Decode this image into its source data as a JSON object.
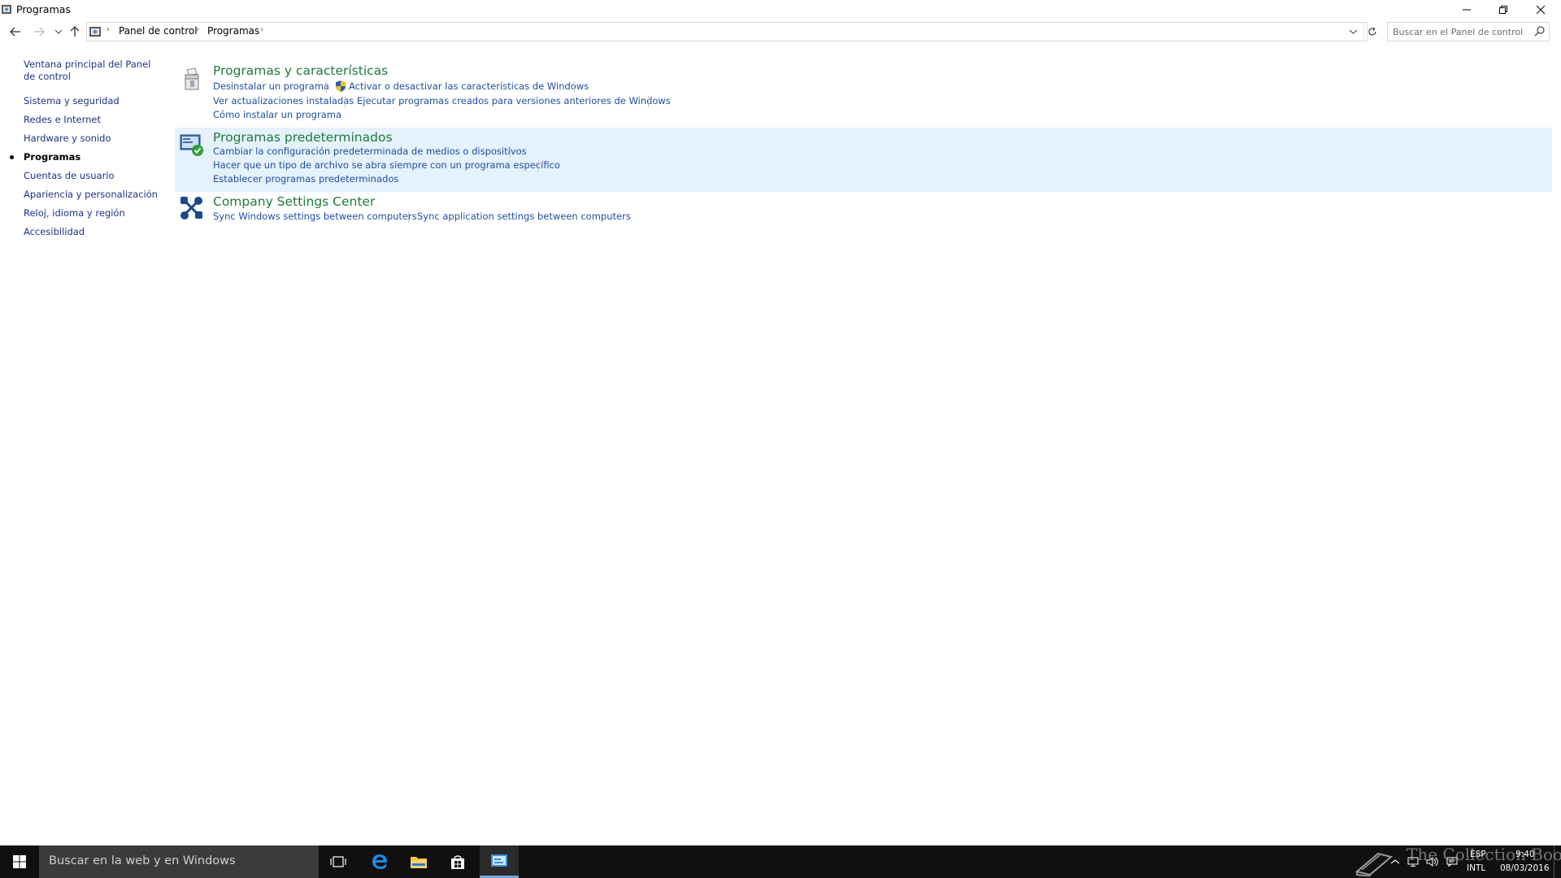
{
  "window": {
    "title": "Programas"
  },
  "breadcrumb": {
    "items": [
      "Panel de control",
      "Programas"
    ]
  },
  "search": {
    "placeholder": "Buscar en el Panel de control"
  },
  "sidebar": {
    "home": "Ventana principal del Panel de control",
    "items": [
      {
        "label": "Sistema y seguridad"
      },
      {
        "label": "Redes e Internet"
      },
      {
        "label": "Hardware y sonido"
      },
      {
        "label": "Programas",
        "current": true
      },
      {
        "label": "Cuentas de usuario"
      },
      {
        "label": "Apariencia y personalización"
      },
      {
        "label": "Reloj, idioma y región"
      },
      {
        "label": "Accesibilidad"
      }
    ]
  },
  "sections": [
    {
      "title": "Programas y características",
      "links": [
        "Desinstalar un programa",
        "Activar o desactivar las características de Windows",
        "Ver actualizaciones instaladas",
        "Ejecutar programas creados para versiones anteriores de Windows",
        "Cómo instalar un programa"
      ]
    },
    {
      "title": "Programas predeterminados",
      "links": [
        "Cambiar la configuración predeterminada de medios o dispositivos",
        "Hacer que un tipo de archivo se abra siempre con un programa específico",
        "Establecer programas predeterminados"
      ]
    },
    {
      "title": "Company Settings Center",
      "links": [
        "Sync Windows settings between computers",
        "Sync application settings between computers"
      ]
    }
  ],
  "taskbar": {
    "search_text": "Buscar en la web y en Windows",
    "lang_top": "ESP",
    "lang_bottom": "INTL",
    "time": "9:40",
    "date": "08/03/2016",
    "watermark": "The Collection Book"
  },
  "colors": {
    "title_green": "#1e7a3b",
    "link_blue": "#1e4fa0",
    "highlight": "#e5f1fb",
    "taskbar": "#101010"
  }
}
